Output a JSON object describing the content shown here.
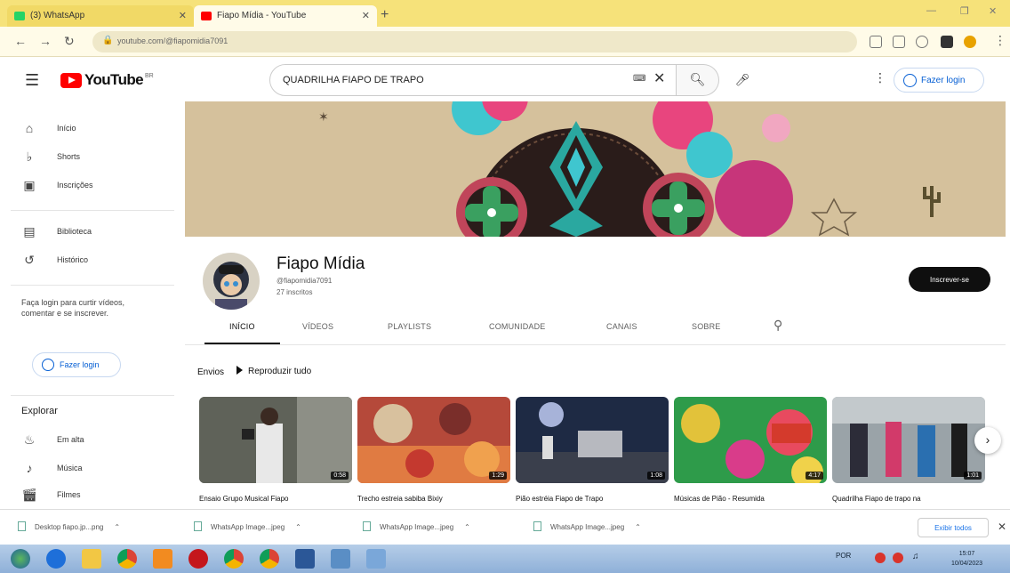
{
  "browser": {
    "tabs": [
      {
        "label": "(3) WhatsApp"
      },
      {
        "label": "Fiapo Mídia - YouTube"
      }
    ],
    "url": "youtube.com/@fiapomidia7091"
  },
  "header": {
    "logo_text": "YouTube",
    "logo_country": "BR",
    "search_value": "QUADRILHA FIAPO DE TRAPO",
    "sign_in": "Fazer login"
  },
  "sidebar": {
    "items_top": [
      {
        "label": "Início",
        "icon": "home-icon"
      },
      {
        "label": "Shorts",
        "icon": "shorts-icon"
      },
      {
        "label": "Inscrições",
        "icon": "subscriptions-icon"
      }
    ],
    "items_mid": [
      {
        "label": "Biblioteca",
        "icon": "library-icon"
      },
      {
        "label": "Histórico",
        "icon": "history-icon"
      }
    ],
    "signin_hint": "Faça login para curtir vídeos, comentar e se inscrever.",
    "signin_button": "Fazer login",
    "explore_title": "Explorar",
    "explore_items": [
      {
        "label": "Em alta",
        "icon": "trending-icon"
      },
      {
        "label": "Música",
        "icon": "music-icon"
      },
      {
        "label": "Filmes",
        "icon": "movies-icon"
      }
    ]
  },
  "channel": {
    "name": "Fiapo Mídia",
    "handle": "@fiapomidia7091",
    "subscribers": "27 inscritos",
    "subscribe_label": "Inscrever-se",
    "tabs": [
      "INÍCIO",
      "VÍDEOS",
      "PLAYLISTS",
      "COMUNIDADE",
      "CANAIS",
      "SOBRE"
    ],
    "active_tab": "INÍCIO"
  },
  "shelf": {
    "title": "Envios",
    "play_all": "Reproduzir tudo",
    "videos": [
      {
        "title": "Ensaio Grupo Musical Fiapo",
        "duration": "0:58"
      },
      {
        "title": "Trecho estreia sabiba Bixiy",
        "duration": "1:29"
      },
      {
        "title": "Pião estréia Fiapo de Trapo",
        "duration": "1:08"
      },
      {
        "title": "Músicas de Pião - Resumida",
        "duration": "4:17"
      },
      {
        "title": "Quadrilha Fiapo de trapo na",
        "duration": "1:01"
      }
    ]
  },
  "downloads": {
    "items": [
      "Desktop fiapo.jp...png",
      "WhatsApp Image...jpeg",
      "WhatsApp Image...jpeg",
      "WhatsApp Image...jpeg"
    ],
    "show_all": "Exibir todos"
  },
  "taskbar": {
    "lang": "POR",
    "time": "15:07",
    "date": "10/04/2023"
  },
  "colors": {
    "youtube_red": "#ff0000",
    "link_blue": "#065fd4",
    "tab_bar": "#f6e27a"
  }
}
